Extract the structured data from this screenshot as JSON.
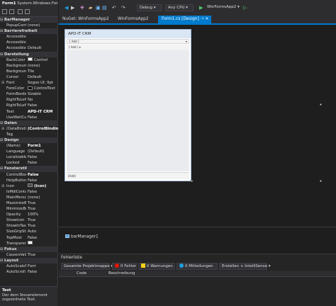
{
  "properties": {
    "header_name": "Form1",
    "header_type": "System.Windows.Forms.Form",
    "rows": [
      {
        "key": "BarManager",
        "cat": true
      },
      {
        "key": "PopupContextMenu",
        "value": "(none)"
      },
      {
        "key": "Barrierefreiheit",
        "cat": true
      },
      {
        "key": "AccessibleDescription",
        "value": ""
      },
      {
        "key": "AccessibleName",
        "value": ""
      },
      {
        "key": "AccessibleRole",
        "value": "Default"
      },
      {
        "key": "Darstellung",
        "cat": true
      },
      {
        "key": "BackColor",
        "value": "Control",
        "swatch": "#f0f0f0"
      },
      {
        "key": "BackgroundImage",
        "value": "(none)"
      },
      {
        "key": "BackgroundImageLayout",
        "value": "Tile"
      },
      {
        "key": "Cursor",
        "value": "Default"
      },
      {
        "key": "Font",
        "value": "Segoe UI; 9pt",
        "expand": true
      },
      {
        "key": "ForeColor",
        "value": "ControlText",
        "swatch": "#000000"
      },
      {
        "key": "FormBorderStyle",
        "value": "Sizable"
      },
      {
        "key": "RightToLeft",
        "value": "No"
      },
      {
        "key": "RightToLeftLayout",
        "value": "False"
      },
      {
        "key": "Text",
        "value": "APD-IT CRM",
        "bold": true
      },
      {
        "key": "UseWaitCursor",
        "value": "False"
      },
      {
        "key": "Daten",
        "cat": true
      },
      {
        "key": "(DataBindings)",
        "value": "(ControlBindings)",
        "bold": true,
        "expand": true
      },
      {
        "key": "Tag",
        "value": ""
      },
      {
        "key": "Design",
        "cat": true
      },
      {
        "key": "(Name)",
        "value": "Form1",
        "bold": true
      },
      {
        "key": "Language",
        "value": "(Default)"
      },
      {
        "key": "Localizable",
        "value": "False"
      },
      {
        "key": "Locked",
        "value": "False"
      },
      {
        "key": "Fensterstil",
        "cat": true
      },
      {
        "key": "ControlBox",
        "value": "False",
        "bold": true
      },
      {
        "key": "HelpButton",
        "value": "False"
      },
      {
        "key": "Icon",
        "value": "(Icon)",
        "bold": true,
        "expand": true,
        "swatch": "#4a4a4a"
      },
      {
        "key": "IsMdiContainer",
        "value": "False"
      },
      {
        "key": "MainMenuStrip",
        "value": "(none)"
      },
      {
        "key": "MaximizeBox",
        "value": "True"
      },
      {
        "key": "MinimizeBox",
        "value": "True"
      },
      {
        "key": "Opacity",
        "value": "100%"
      },
      {
        "key": "ShowIcon",
        "value": "True"
      },
      {
        "key": "ShowInTaskbar",
        "value": "True"
      },
      {
        "key": "SizeGripStyle",
        "value": "Auto"
      },
      {
        "key": "TopMost",
        "value": "False"
      },
      {
        "key": "TransparencyKey",
        "value": "",
        "swatch": "#ffffff"
      },
      {
        "key": "Fokus",
        "cat": true
      },
      {
        "key": "CausesValidation",
        "value": "True"
      },
      {
        "key": "Layout",
        "cat": true
      },
      {
        "key": "AutoScaleMode",
        "value": "Font"
      },
      {
        "key": "AutoScroll",
        "value": "False"
      }
    ],
    "desc_title": "Text",
    "desc_body": "Der dem Steuerelement zugeordnete Text."
  },
  "toolbar": {
    "config": "Debug",
    "platform": "Any CPU",
    "start": "WinFormsApp2"
  },
  "tabs": [
    {
      "label": "NuGet: WinFormsApp2",
      "active": false
    },
    {
      "label": "WinFormsApp2",
      "active": false
    },
    {
      "label": "Form1.cs [Design]",
      "active": true
    }
  ],
  "form": {
    "title": "APD-IT CRM",
    "bar1": "[ Add ]",
    "bar2": "[ Add ]",
    "status": "[Add]"
  },
  "tray": {
    "item": "barManager1"
  },
  "errors": {
    "title": "Fehlerliste",
    "scope": "Gesamte Projektmappe",
    "errors": "0 Fehler",
    "warnings": "0 Warnungen",
    "messages": "0 Mitteilungen",
    "build": "Erstellen + IntelliSense",
    "col_code": "Code",
    "col_desc": "Beschreibung"
  },
  "colors": {
    "accent": "#007acc",
    "error": "#e51400",
    "warning": "#fcd116",
    "info": "#1ba1e2"
  }
}
